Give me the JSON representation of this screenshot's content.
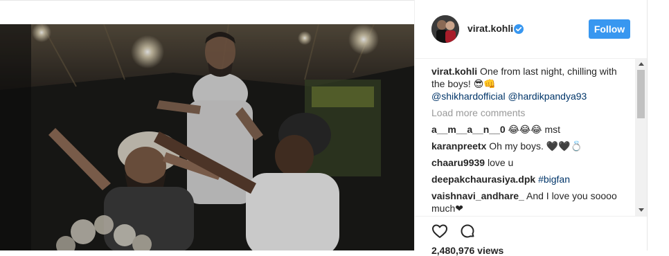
{
  "post": {
    "author": {
      "username": "virat.kohli",
      "verified": true
    },
    "follow_label": "Follow",
    "caption": {
      "username": "virat.kohli",
      "text": "One from last night, chilling with the boys! 😎👊",
      "mentions": [
        "@shikhardofficial",
        "@hardikpandya93"
      ]
    },
    "load_more": "Load more comments",
    "comments": [
      {
        "username": "a__m__a__n__0",
        "text": "😂😂😂 mst"
      },
      {
        "username": "karanpreetx",
        "text": "Oh my boys. 🖤🖤💍"
      },
      {
        "username": "chaaru9939",
        "text": "love u"
      },
      {
        "username": "deepakchaurasiya.dpk",
        "text": "#bigfan"
      },
      {
        "username": "vaishnavi_andhare_",
        "text": "And I love you soooo much❤"
      }
    ],
    "views": "2,480,976 views"
  },
  "icons": {
    "heart": "heart-icon",
    "comment": "comment-bubble-icon",
    "verified": "verified-badge-icon"
  },
  "colors": {
    "follow_button": "#3897f0",
    "link": "#003569",
    "muted": "#999999",
    "verified": "#3897f0"
  }
}
